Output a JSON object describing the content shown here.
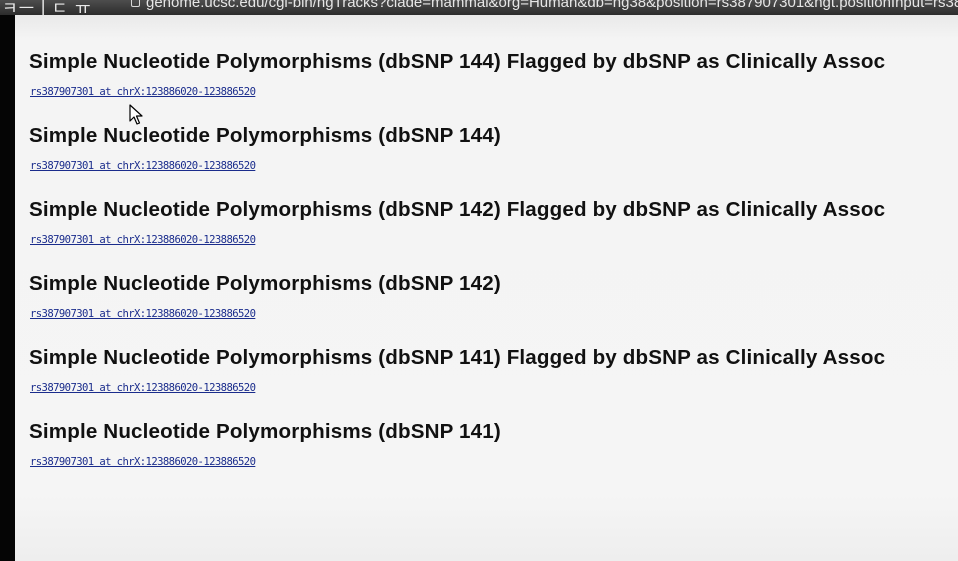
{
  "browser": {
    "partial_glyphs": "ㅋㅡㅣㄷ ㅠ",
    "url": "genome.ucsc.edu/cgi-bin/hgTracks?clade=mammal&org=Human&db=hg38&position=rs387907301&hgt.positionInput=rs38"
  },
  "results": [
    {
      "title": "Simple Nucleotide Polymorphisms (dbSNP 144) Flagged by dbSNP as Clinically Assoc",
      "link": "rs387907301 at chrX:123886020-123886520"
    },
    {
      "title": "Simple Nucleotide Polymorphisms (dbSNP 144)",
      "link": "rs387907301 at chrX:123886020-123886520"
    },
    {
      "title": "Simple Nucleotide Polymorphisms (dbSNP 142) Flagged by dbSNP as Clinically Assoc",
      "link": "rs387907301 at chrX:123886020-123886520"
    },
    {
      "title": "Simple Nucleotide Polymorphisms (dbSNP 142)",
      "link": "rs387907301 at chrX:123886020-123886520"
    },
    {
      "title": "Simple Nucleotide Polymorphisms (dbSNP 141) Flagged by dbSNP as Clinically Assoc",
      "link": "rs387907301 at chrX:123886020-123886520"
    },
    {
      "title": "Simple Nucleotide Polymorphisms (dbSNP 141)",
      "link": "rs387907301 at chrX:123886020-123886520"
    }
  ]
}
